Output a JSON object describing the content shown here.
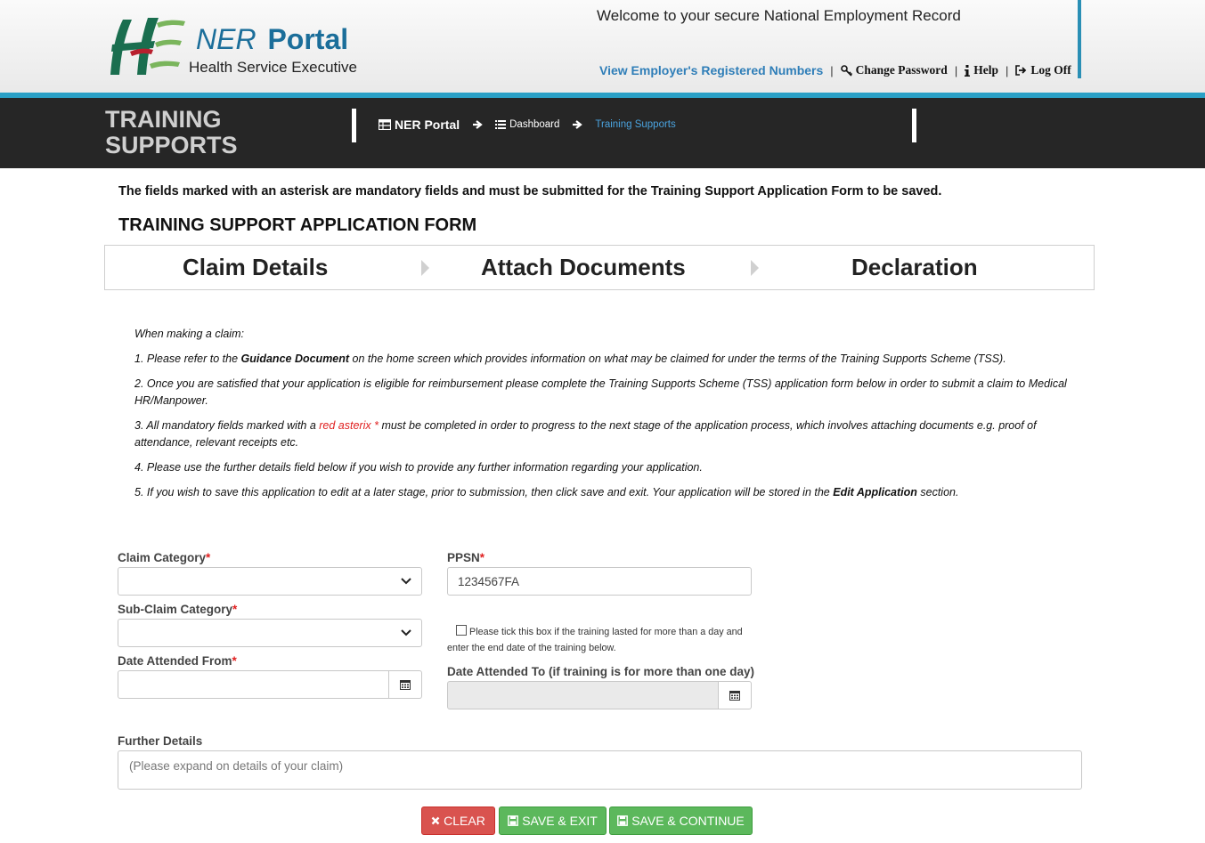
{
  "header": {
    "brand_ner": "NER",
    "brand_portal": "Portal",
    "brand_sub": "Health Service Executive",
    "welcome": "Welcome to your secure National Employment Record",
    "links": {
      "employer_numbers": "View Employer's Registered Numbers",
      "change_password": "Change Password",
      "help": "Help",
      "log_off": "Log Off",
      "separator": "|"
    }
  },
  "darkbar": {
    "title_line1": "TRAINING",
    "title_line2": "SUPPORTS",
    "breadcrumbs": [
      "NER Portal",
      "Dashboard",
      "Training Supports"
    ]
  },
  "notice": "The fields marked with an asterisk are mandatory fields and must be submitted for the Training Support Application Form to be saved.",
  "form_title": "TRAINING SUPPORT APPLICATION FORM",
  "steps": [
    "Claim Details",
    "Attach Documents",
    "Declaration"
  ],
  "instructions": {
    "intro": "When making a claim:",
    "item1": {
      "a": "1. Please refer to the ",
      "b": "Guidance Document",
      "c": " on the home screen which provides information on what may be claimed for under the terms of the Training Supports Scheme (TSS)."
    },
    "item2": "2. Once you are satisfied that your application is eligible for reimbursement please complete the Training Supports Scheme (TSS) application form below in order to submit a claim to Medical HR/Manpower.",
    "item3": {
      "a": "3. All mandatory fields marked with a ",
      "b": "red asterix *",
      "c": " must be completed in order to progress to the next stage of the application process, which involves attaching documents e.g. proof of attendance, relevant receipts etc."
    },
    "item4": "4. Please use the further details field below if you wish to provide any further information regarding your application.",
    "item5": {
      "a": "5. If you wish to save this application to edit at a later stage, prior to submission, then click save and exit. Your application will be stored in the ",
      "b": "Edit Application",
      "c": " section."
    }
  },
  "form": {
    "required_mark": "*",
    "claim_category_label": "Claim Category",
    "claim_category_value": "",
    "sub_claim_category_label": "Sub-Claim Category",
    "sub_claim_category_value": "",
    "date_from_label": "Date Attended From",
    "date_from_value": "",
    "ppsn_label": "PPSN",
    "ppsn_value": "1234567FA",
    "multi_day_check_label": "Please tick this box if the training lasted for more than a day and enter the end date of the training below.",
    "multi_day_checked": false,
    "date_to_label": "Date Attended To (if training is for more than one day)",
    "date_to_value": "",
    "further_details_label": "Further Details",
    "further_details_placeholder": "(Please expand on details of your claim)"
  },
  "buttons": {
    "clear": "CLEAR",
    "save_exit": "SAVE & EXIT",
    "save_continue": "SAVE & CONTINUE"
  },
  "colors": {
    "accent_blue": "#2aa0c6",
    "dark_bar": "#262626",
    "danger": "#d9534f",
    "success": "#5cb85c",
    "required": "#e02020"
  }
}
